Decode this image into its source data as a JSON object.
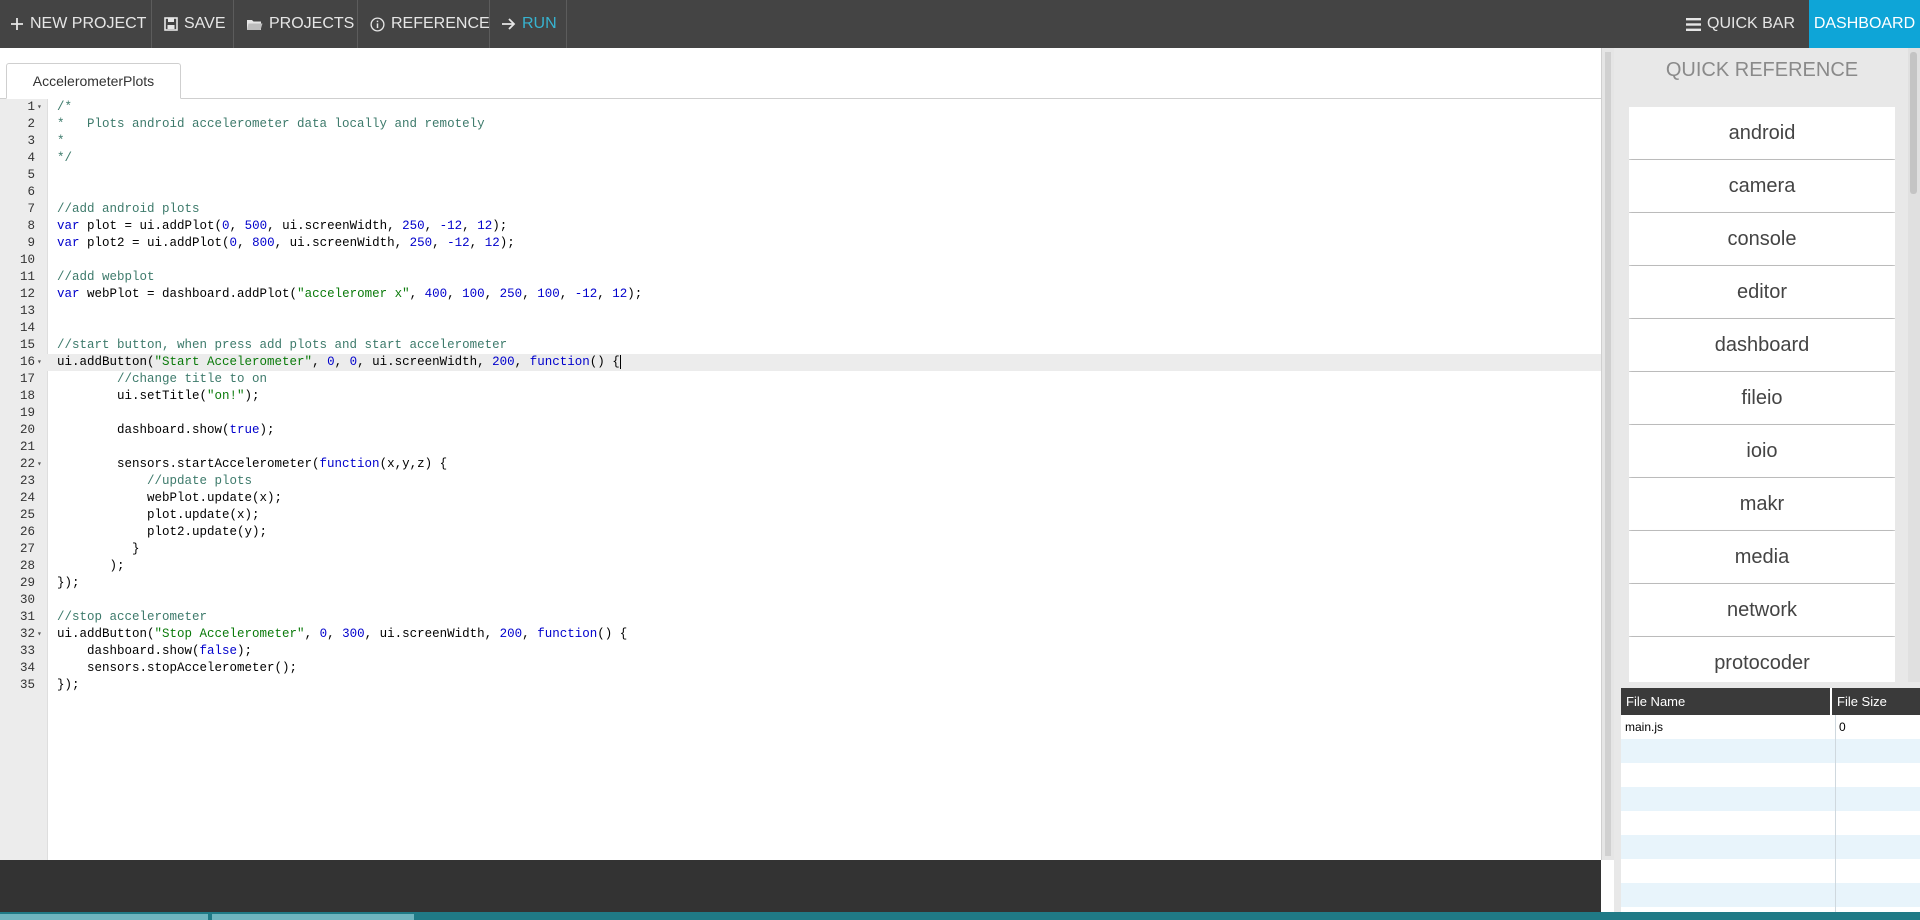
{
  "toolbar": {
    "new_project": "NEW PROJECT",
    "save": "SAVE",
    "projects": "PROJECTS",
    "reference": "REFERENCE",
    "run": "RUN",
    "quick_bar": "QUICK BAR",
    "dashboard": "DASHBOARD"
  },
  "editor": {
    "tab": "AccelerometerPlots",
    "lines": [
      {
        "n": "1",
        "fold": true,
        "t": [
          [
            "c",
            "/*"
          ]
        ]
      },
      {
        "n": "2",
        "t": [
          [
            "c",
            "*   Plots android accelerometer data locally and remotely"
          ]
        ]
      },
      {
        "n": "3",
        "t": [
          [
            "c",
            "*"
          ]
        ]
      },
      {
        "n": "4",
        "t": [
          [
            "c",
            "*/"
          ]
        ]
      },
      {
        "n": "5",
        "t": []
      },
      {
        "n": "6",
        "t": []
      },
      {
        "n": "7",
        "t": [
          [
            "c",
            "//add android plots"
          ]
        ]
      },
      {
        "n": "8",
        "t": [
          [
            "k",
            "var"
          ],
          [
            "p",
            " plot = ui.addPlot("
          ],
          [
            "n",
            "0"
          ],
          [
            "p",
            ", "
          ],
          [
            "n",
            "500"
          ],
          [
            "p",
            ", ui.screenWidth, "
          ],
          [
            "n",
            "250"
          ],
          [
            "p",
            ", "
          ],
          [
            "n",
            "-12"
          ],
          [
            "p",
            ", "
          ],
          [
            "n",
            "12"
          ],
          [
            "p",
            ");"
          ]
        ]
      },
      {
        "n": "9",
        "t": [
          [
            "k",
            "var"
          ],
          [
            "p",
            " plot2 = ui.addPlot("
          ],
          [
            "n",
            "0"
          ],
          [
            "p",
            ", "
          ],
          [
            "n",
            "800"
          ],
          [
            "p",
            ", ui.screenWidth, "
          ],
          [
            "n",
            "250"
          ],
          [
            "p",
            ", "
          ],
          [
            "n",
            "-12"
          ],
          [
            "p",
            ", "
          ],
          [
            "n",
            "12"
          ],
          [
            "p",
            ");"
          ]
        ]
      },
      {
        "n": "10",
        "t": []
      },
      {
        "n": "11",
        "t": [
          [
            "c",
            "//add webplot"
          ]
        ]
      },
      {
        "n": "12",
        "t": [
          [
            "k",
            "var"
          ],
          [
            "p",
            " webPlot = dashboard.addPlot("
          ],
          [
            "s",
            "\"acceleromer x\""
          ],
          [
            "p",
            ", "
          ],
          [
            "n",
            "400"
          ],
          [
            "p",
            ", "
          ],
          [
            "n",
            "100"
          ],
          [
            "p",
            ", "
          ],
          [
            "n",
            "250"
          ],
          [
            "p",
            ", "
          ],
          [
            "n",
            "100"
          ],
          [
            "p",
            ", "
          ],
          [
            "n",
            "-12"
          ],
          [
            "p",
            ", "
          ],
          [
            "n",
            "12"
          ],
          [
            "p",
            ");"
          ]
        ]
      },
      {
        "n": "13",
        "t": []
      },
      {
        "n": "14",
        "t": []
      },
      {
        "n": "15",
        "t": [
          [
            "c",
            "//start button, when press add plots and start accelerometer"
          ]
        ]
      },
      {
        "n": "16",
        "fold": true,
        "active": true,
        "t": [
          [
            "p",
            "ui.addButton("
          ],
          [
            "s",
            "\"Start Accelerometer\""
          ],
          [
            "p",
            ", "
          ],
          [
            "n",
            "0"
          ],
          [
            "p",
            ", "
          ],
          [
            "n",
            "0"
          ],
          [
            "p",
            ", ui.screenWidth, "
          ],
          [
            "n",
            "200"
          ],
          [
            "p",
            ", "
          ],
          [
            "k",
            "function"
          ],
          [
            "p",
            "() {"
          ]
        ],
        "cursor": true
      },
      {
        "n": "17",
        "t": [
          [
            "p",
            "        "
          ],
          [
            "c",
            "//change title to on"
          ]
        ]
      },
      {
        "n": "18",
        "t": [
          [
            "p",
            "        ui.setTitle("
          ],
          [
            "s",
            "\"on!\""
          ],
          [
            "p",
            ");"
          ]
        ]
      },
      {
        "n": "19",
        "t": []
      },
      {
        "n": "20",
        "t": [
          [
            "p",
            "        dashboard.show("
          ],
          [
            "k",
            "true"
          ],
          [
            "p",
            ");"
          ]
        ]
      },
      {
        "n": "21",
        "t": []
      },
      {
        "n": "22",
        "fold": true,
        "t": [
          [
            "p",
            "        sensors.startAccelerometer("
          ],
          [
            "k",
            "function"
          ],
          [
            "p",
            "(x,y,z) {"
          ]
        ]
      },
      {
        "n": "23",
        "t": [
          [
            "p",
            "            "
          ],
          [
            "c",
            "//update plots"
          ]
        ]
      },
      {
        "n": "24",
        "t": [
          [
            "p",
            "            webPlot.update(x);"
          ]
        ]
      },
      {
        "n": "25",
        "t": [
          [
            "p",
            "            plot.update(x);"
          ]
        ]
      },
      {
        "n": "26",
        "t": [
          [
            "p",
            "            plot2.update(y);"
          ]
        ]
      },
      {
        "n": "27",
        "t": [
          [
            "p",
            "          }"
          ]
        ]
      },
      {
        "n": "28",
        "t": [
          [
            "p",
            "       );"
          ]
        ]
      },
      {
        "n": "29",
        "t": [
          [
            "p",
            "});"
          ]
        ]
      },
      {
        "n": "30",
        "t": []
      },
      {
        "n": "31",
        "t": [
          [
            "c",
            "//stop accelerometer"
          ]
        ]
      },
      {
        "n": "32",
        "fold": true,
        "t": [
          [
            "p",
            "ui.addButton("
          ],
          [
            "s",
            "\"Stop Accelerometer\""
          ],
          [
            "p",
            ", "
          ],
          [
            "n",
            "0"
          ],
          [
            "p",
            ", "
          ],
          [
            "n",
            "300"
          ],
          [
            "p",
            ", ui.screenWidth, "
          ],
          [
            "n",
            "200"
          ],
          [
            "p",
            ", "
          ],
          [
            "k",
            "function"
          ],
          [
            "p",
            "() {"
          ]
        ]
      },
      {
        "n": "33",
        "t": [
          [
            "p",
            "    dashboard.show("
          ],
          [
            "k",
            "false"
          ],
          [
            "p",
            ");"
          ]
        ]
      },
      {
        "n": "34",
        "t": [
          [
            "p",
            "    sensors.stopAccelerometer();"
          ]
        ]
      },
      {
        "n": "35",
        "t": [
          [
            "p",
            "});"
          ]
        ]
      }
    ]
  },
  "quick_reference": {
    "title": "QUICK REFERENCE",
    "items": [
      "android",
      "camera",
      "console",
      "editor",
      "dashboard",
      "fileio",
      "ioio",
      "makr",
      "media",
      "network",
      "protocoder"
    ]
  },
  "files": {
    "columns": [
      "File Name",
      "File Size"
    ],
    "rows": [
      {
        "name": "main.js",
        "size": "0"
      }
    ]
  },
  "colors": {
    "toolbar_bg": "#444444",
    "accent": "#0ea5d7",
    "run": "#37b3d0"
  }
}
